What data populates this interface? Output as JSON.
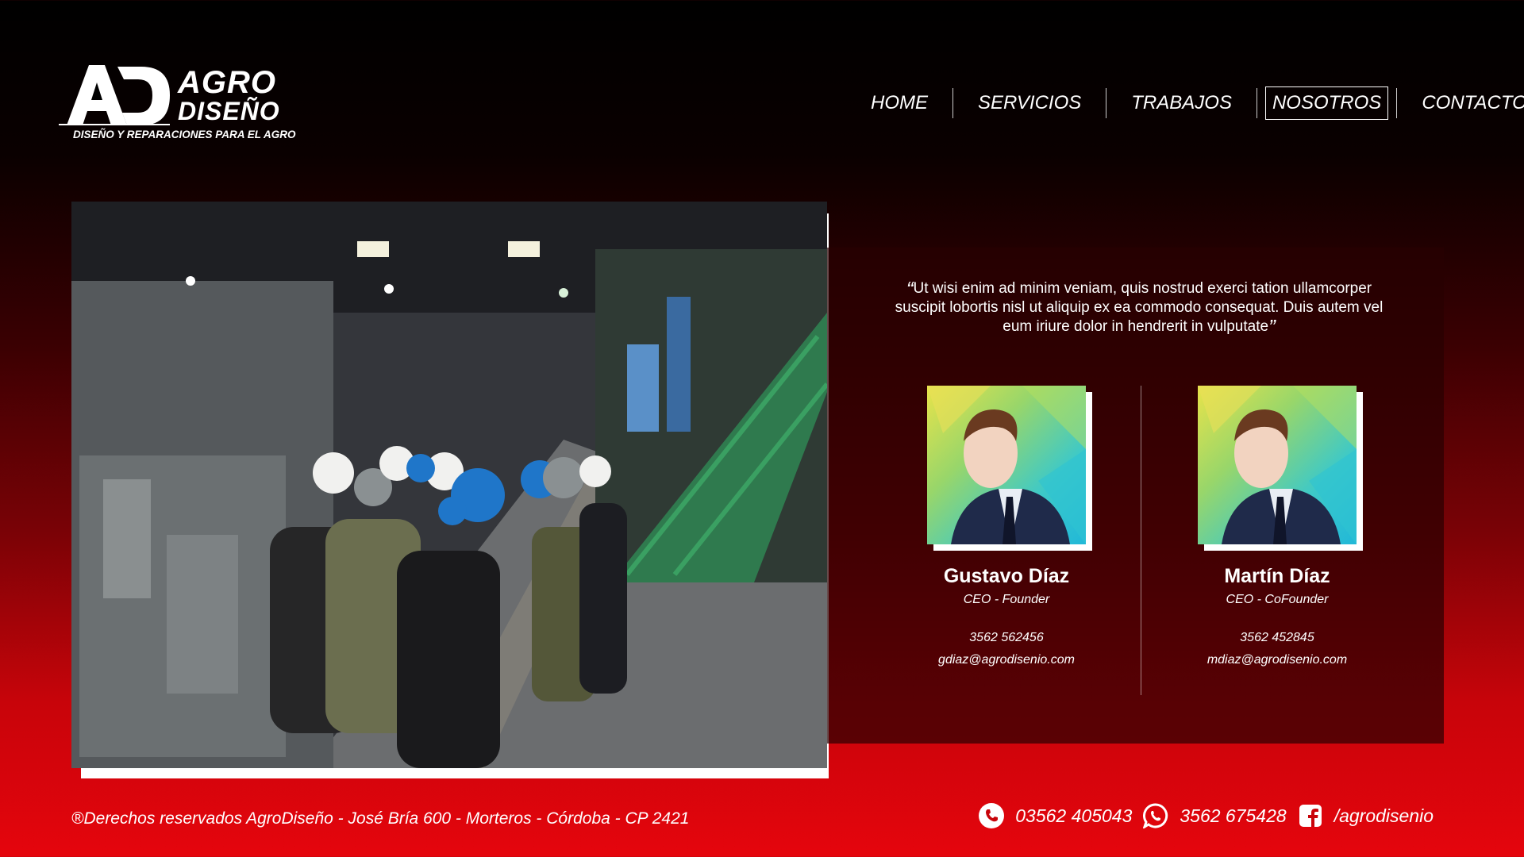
{
  "brand": {
    "line1": "AGRO",
    "line2": "DISEÑO",
    "tagline": "DISEÑO Y REPARACIONES PARA EL AGRO"
  },
  "nav": {
    "items": [
      {
        "label": "HOME"
      },
      {
        "label": "SERVICIOS"
      },
      {
        "label": "TRABAJOS"
      },
      {
        "label": "NOSOTROS",
        "active": true
      },
      {
        "label": "CONTACTO"
      }
    ]
  },
  "about": {
    "quote": "Ut wisi enim ad minim veniam, quis nostrud exerci tation ullamcorper suscipit lobortis nisl ut aliquip ex ea commodo consequat. Duis autem vel eum iriure dolor in hendrerit in vulputate",
    "members": [
      {
        "name": "Gustavo Díaz",
        "role": "CEO - Founder",
        "phone": "3562 562456",
        "email": "gdiaz@agrodisenio.com"
      },
      {
        "name": "Martín Díaz",
        "role": "CEO - CoFounder",
        "phone": "3562 452845",
        "email": "mdiaz@agrodisenio.com"
      }
    ]
  },
  "footer": {
    "copyright": "®Derechos reservados AgroDiseño - José Bría 600  - Morteros - Córdoba - CP 2421",
    "phone": "03562 405043",
    "whatsapp": "3562 675428",
    "facebook": "/agrodisenio"
  },
  "icons": [
    "phone-icon",
    "whatsapp-icon",
    "facebook-icon",
    "quote-open-icon",
    "quote-close-icon"
  ],
  "colors": {
    "accent_red": "#e5050d",
    "background_dark": "#000000"
  }
}
